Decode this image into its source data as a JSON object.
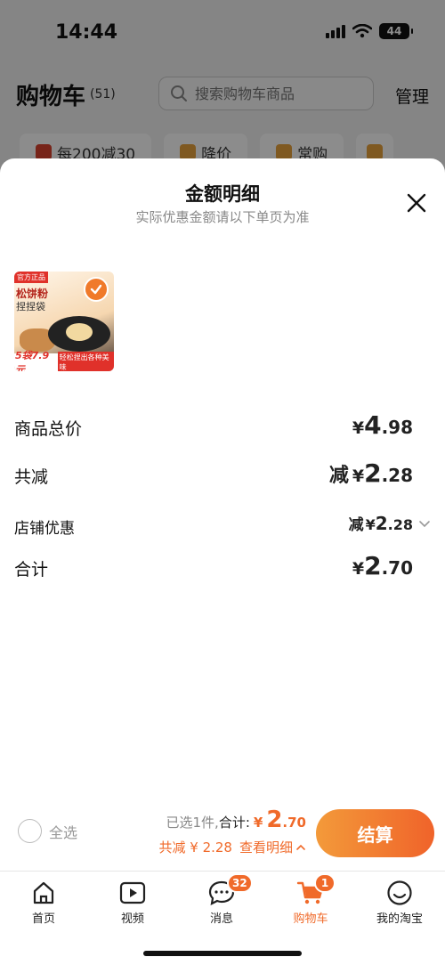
{
  "status_bar": {
    "time": "14:44",
    "battery": "44"
  },
  "background": {
    "title": "购物车",
    "count": "(51)",
    "search_placeholder": "搜索购物车商品",
    "manage": "管理",
    "filters": [
      "每200减30",
      "降价",
      "常购"
    ]
  },
  "sheet": {
    "title": "金额明细",
    "subtitle": "实际优惠金额请以下单页为准",
    "product": {
      "tag": "官方正品",
      "name_line1": "松饼粉",
      "name_line2": "捏捏袋",
      "price_badge": "5袋7.9元",
      "slogan": "轻松捏出各种美味"
    },
    "rows": {
      "goods_total": {
        "label": "商品总价",
        "yen": "¥",
        "int": "4",
        "dec": ".98"
      },
      "total_discount": {
        "label": "共减",
        "prefix": "减",
        "yen": "¥",
        "int": "2",
        "dec": ".28"
      },
      "store_discount": {
        "label": "店铺优惠",
        "prefix": "减",
        "yen": "¥",
        "int": "2",
        "dec": ".28"
      },
      "sum": {
        "label": "合计",
        "yen": "¥",
        "int": "2",
        "dec": ".70"
      }
    }
  },
  "checkout": {
    "select_all": "全选",
    "selected": "已选1件,",
    "total_label": "合计:",
    "total_yen": "¥",
    "total_int": "2",
    "total_dec": ".70",
    "discount_text": "共减 ¥ 2.28",
    "detail_link": "查看明细",
    "button": "结算"
  },
  "tabbar": {
    "tabs": [
      {
        "label": "首页",
        "icon": "home-icon"
      },
      {
        "label": "视频",
        "icon": "video-icon"
      },
      {
        "label": "消息",
        "icon": "message-icon",
        "badge": "32"
      },
      {
        "label": "购物车",
        "icon": "cart-icon",
        "badge": "1",
        "active": true
      },
      {
        "label": "我的淘宝",
        "icon": "profile-icon"
      }
    ]
  },
  "colors": {
    "accent": "#f06a2a",
    "text": "#222222"
  }
}
